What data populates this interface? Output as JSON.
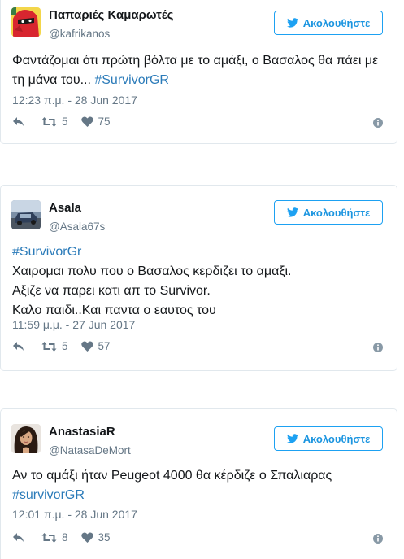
{
  "colors": {
    "link": "#2b7bb9",
    "follow_border": "#1da1f2",
    "follow_text": "#1b95e0",
    "muted": "#657786",
    "text": "#14171a",
    "card_border": "#e1e8ed"
  },
  "follow_label": "Ακολουθήστε",
  "tweets": [
    {
      "name": "Παπαριές Καμαρωτές",
      "handle": "@kafrikanos",
      "avatar_icon": "red-ninja-avatar",
      "lines": [
        {
          "text": "Φαντάζομαι ότι πρώτη βόλτα με το αμάξι, ο Βασαλος θα πάει με",
          "hashtag": ""
        },
        {
          "text": "τη μάνα του... ",
          "hashtag": "#SurvivorGR"
        }
      ],
      "timestamp": "12:23 π.μ. - 28 Jun 2017",
      "retweets": "5",
      "likes": "75"
    },
    {
      "name": "Asala",
      "handle": "@Asala67s",
      "avatar_icon": "car-photo-avatar",
      "lines": [
        {
          "text": "",
          "hashtag": "#SurvivorGr"
        },
        {
          "text": "Χαιρομαι πολυ που ο Βασαλος κερδιζει το αμαξι.",
          "hashtag": ""
        },
        {
          "text": "Αξιζε να παρει κατι απ το Survivor.",
          "hashtag": ""
        },
        {
          "text": "Καλο παιδι..Και παντα ο εαυτος του",
          "hashtag": ""
        }
      ],
      "timestamp": "11:59 μ.μ. - 27 Jun 2017",
      "retweets": "5",
      "likes": "57"
    },
    {
      "name": "AnastasiaR",
      "handle": "@NatasaDeMort",
      "avatar_icon": "woman-portrait-avatar",
      "lines": [
        {
          "text": "Αν το αμάξι ήταν Peugeot 4000 θα κέρδιζε ο Σπαλιαρας",
          "hashtag": ""
        },
        {
          "text": "",
          "hashtag": "#survivorGR"
        }
      ],
      "timestamp": "12:01 π.μ. - 28 Jun 2017",
      "retweets": "8",
      "likes": "35"
    }
  ]
}
